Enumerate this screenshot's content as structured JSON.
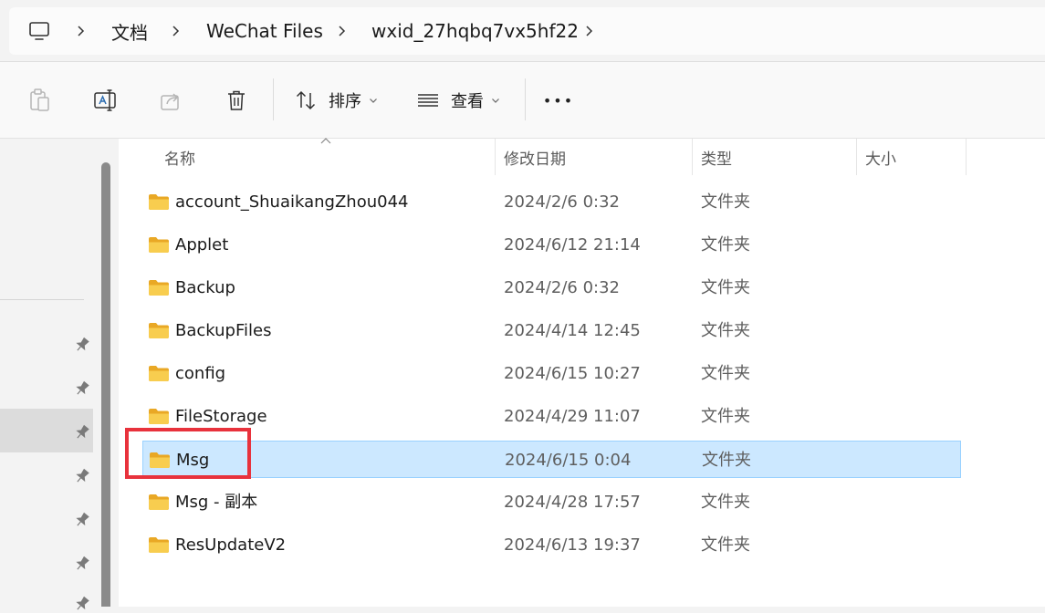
{
  "address_bar": {
    "crumbs": [
      "文档",
      "WeChat Files",
      "wxid_27hqbq7vx5hf22"
    ]
  },
  "toolbar": {
    "sort_label": "排序",
    "view_label": "查看",
    "more_label": "•••"
  },
  "columns": {
    "name": "名称",
    "date": "修改日期",
    "type": "类型",
    "size": "大小"
  },
  "files": [
    {
      "name": "account_ShuaikangZhou044",
      "date": "2024/2/6 0:32",
      "type": "文件夹"
    },
    {
      "name": "Applet",
      "date": "2024/6/12 21:14",
      "type": "文件夹"
    },
    {
      "name": "Backup",
      "date": "2024/2/6 0:32",
      "type": "文件夹"
    },
    {
      "name": "BackupFiles",
      "date": "2024/4/14 12:45",
      "type": "文件夹"
    },
    {
      "name": "config",
      "date": "2024/6/15 10:27",
      "type": "文件夹"
    },
    {
      "name": "FileStorage",
      "date": "2024/4/29 11:07",
      "type": "文件夹"
    },
    {
      "name": "Msg",
      "date": "2024/6/15 0:04",
      "type": "文件夹"
    },
    {
      "name": "Msg - 副本",
      "date": "2024/4/28 17:57",
      "type": "文件夹"
    },
    {
      "name": "ResUpdateV2",
      "date": "2024/6/13 19:37",
      "type": "文件夹"
    }
  ],
  "selected_file": "Msg",
  "colors": {
    "selection_bg": "#cce8ff",
    "selection_border": "#99d1ff",
    "highlight_box": "#e8323c",
    "folder_yellow": "#f6c343"
  }
}
